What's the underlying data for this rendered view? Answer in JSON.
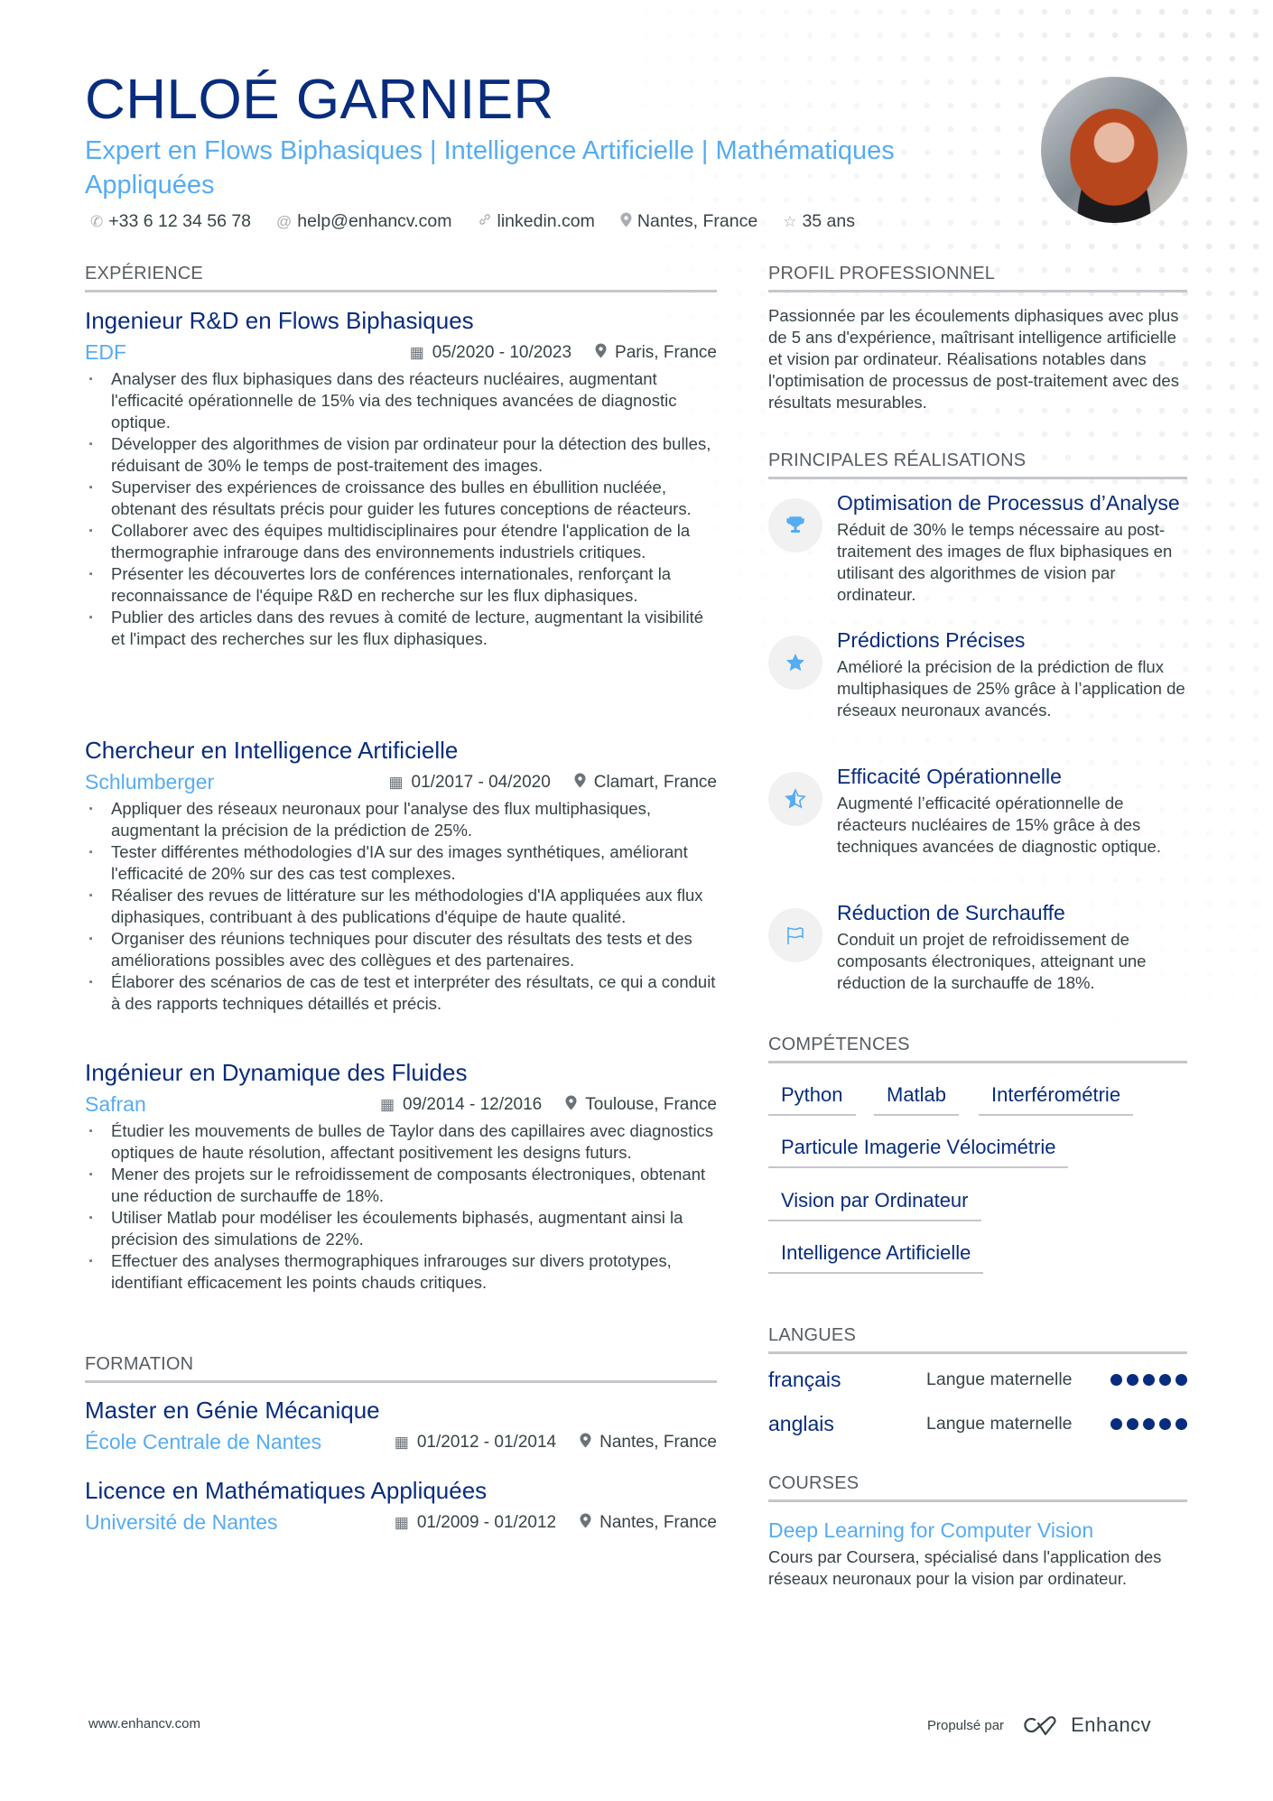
{
  "header": {
    "name": "CHLOÉ GARNIER",
    "subtitle": "Expert en Flows Biphasiques | Intelligence Artificielle | Mathématiques Appliquées",
    "contacts": [
      {
        "icon": "phone-icon",
        "glyph": "✆",
        "text": "+33 6 12 34 56 78"
      },
      {
        "icon": "at-icon",
        "glyph": "@",
        "text": "help@enhancv.com"
      },
      {
        "icon": "link-icon",
        "glyph": "🔗︎",
        "text": "linkedin.com"
      },
      {
        "icon": "location-icon",
        "glyph": "⚲",
        "text": "Nantes, France"
      },
      {
        "icon": "star-icon",
        "glyph": "☆",
        "text": "35 ans"
      }
    ]
  },
  "experience": {
    "title": "EXPÉRIENCE",
    "jobs": [
      {
        "title": "Ingenieur R&D en Flows Biphasiques",
        "company": "EDF",
        "dates": "05/2020 - 10/2023",
        "location": "Paris, France",
        "bullets": [
          "Analyser des flux biphasiques dans des réacteurs nucléaires, augmentant l'efficacité opérationnelle de 15% via des techniques avancées de diagnostic optique.",
          "Développer des algorithmes de vision par ordinateur pour la détection des bulles, réduisant de 30% le temps de post-traitement des images.",
          "Superviser des expériences de croissance des bulles en ébullition nucléée, obtenant des résultats précis pour guider les futures conceptions de réacteurs.",
          "Collaborer avec des équipes multidisciplinaires pour étendre l'application de la thermographie infrarouge dans des environnements industriels critiques.",
          "Présenter les découvertes lors de conférences internationales, renforçant la reconnaissance de l'équipe R&D en recherche sur les flux diphasiques.",
          "Publier des articles dans des revues à comité de lecture, augmentant la visibilité et l'impact des recherches sur les flux diphasiques."
        ]
      },
      {
        "title": "Chercheur en Intelligence Artificielle",
        "company": "Schlumberger",
        "dates": "01/2017 - 04/2020",
        "location": "Clamart, France",
        "bullets": [
          "Appliquer des réseaux neuronaux pour l'analyse des flux multiphasiques, augmentant la précision de la prédiction de 25%.",
          "Tester différentes méthodologies d'IA sur des images synthétiques, améliorant l'efficacité de 20% sur des cas test complexes.",
          "Réaliser des revues de littérature sur les méthodologies d'IA appliquées aux flux diphasiques, contribuant à des publications d'équipe de haute qualité.",
          "Organiser des réunions techniques pour discuter des résultats des tests et des améliorations possibles avec des collègues et des partenaires.",
          "Élaborer des scénarios de cas de test et interpréter des résultats, ce qui a conduit à des rapports techniques détaillés et précis."
        ]
      },
      {
        "title": "Ingénieur en Dynamique des Fluides",
        "company": "Safran",
        "dates": "09/2014 - 12/2016",
        "location": "Toulouse, France",
        "bullets": [
          "Étudier les mouvements de bulles de Taylor dans des capillaires avec diagnostics optiques de haute résolution, affectant positivement les designs futurs.",
          "Mener des projets sur le refroidissement de composants électroniques, obtenant une réduction de surchauffe de 18%.",
          "Utiliser Matlab pour modéliser les écoulements biphasés, augmentant ainsi la précision des simulations de 22%.",
          "Effectuer des analyses thermographiques infrarouges sur divers prototypes, identifiant efficacement les points chauds critiques."
        ]
      }
    ]
  },
  "education": {
    "title": "FORMATION",
    "items": [
      {
        "degree": "Master en Génie Mécanique",
        "school": "École Centrale de Nantes",
        "dates": "01/2012 - 01/2014",
        "location": "Nantes, France"
      },
      {
        "degree": "Licence en Mathématiques Appliquées",
        "school": "Université de Nantes",
        "dates": "01/2009 - 01/2012",
        "location": "Nantes, France"
      }
    ]
  },
  "profile": {
    "title": "PROFIL PROFESSIONNEL",
    "text": "Passionnée par les écoulements diphasiques avec plus de 5 ans d'expérience, maîtrisant intelligence artificielle et vision par ordinateur. Réalisations notables dans l'optimisation de processus de post-traitement avec des résultats mesurables."
  },
  "achievements": {
    "title": "PRINCIPALES RÉALISATIONS",
    "items": [
      {
        "icon": "trophy-icon",
        "glyph": "🏆︎",
        "title": "Optimisation de Processus d’Analyse",
        "desc": "Réduit de 30% le temps nécessaire au post-traitement des images de flux biphasiques en utilisant des algorithmes de vision par ordinateur."
      },
      {
        "icon": "star-icon",
        "glyph": "★",
        "title": "Prédictions Précises",
        "desc": "Amélioré la précision de la prédiction de flux multiphasiques de 25% grâce à l’application de réseaux neuronaux avancés."
      },
      {
        "icon": "half-star-icon",
        "glyph": "⯪",
        "title": "Efficacité Opérationnelle",
        "desc": "Augmenté l’efficacité opérationnelle de réacteurs nucléaires de 15% grâce à des techniques avancées de diagnostic optique."
      },
      {
        "icon": "flag-icon",
        "glyph": "⚐",
        "title": "Réduction de Surchauffe",
        "desc": "Conduit un projet de refroidissement de composants électroniques, atteignant une réduction de la surchauffe de 18%."
      }
    ]
  },
  "skills": {
    "title": "COMPÉTENCES",
    "items": [
      "Python",
      "Matlab",
      "Interférométrie",
      "Particule Imagerie Vélocimétrie",
      "Vision par Ordinateur",
      "Intelligence Artificielle"
    ]
  },
  "languages": {
    "title": "LANGUES",
    "items": [
      {
        "name": "français",
        "level": "Langue maternelle",
        "rating": 5,
        "max": 5
      },
      {
        "name": "anglais",
        "level": "Langue maternelle",
        "rating": 5,
        "max": 5
      }
    ]
  },
  "courses": {
    "title": "COURSES",
    "items": [
      {
        "title": "Deep Learning for Computer Vision",
        "desc": "Cours par Coursera, spécialisé dans l'application des réseaux neuronaux pour la vision par ordinateur."
      }
    ]
  },
  "footer": {
    "website": "www.enhancv.com",
    "powered_by": "Propulsé par",
    "brand": "Enhancv"
  },
  "colors": {
    "primary": "#082c7e",
    "accent": "#56acf2",
    "text": "#384347"
  }
}
